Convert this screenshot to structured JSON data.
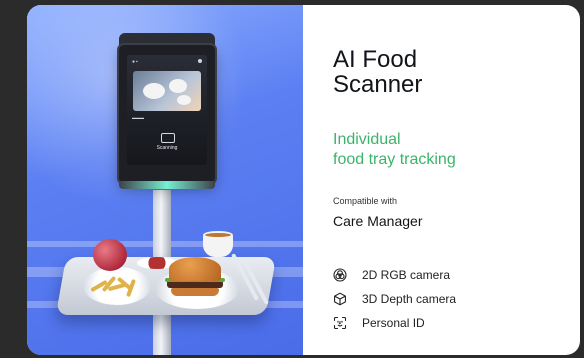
{
  "product": {
    "title_line1": "AI Food",
    "title_line2": "Scanner",
    "subtitle_line1": "Individual",
    "subtitle_line2": "food tray tracking",
    "accent_color": "#3bb46a"
  },
  "compatibility": {
    "label": "Compatible with",
    "value": "Care Manager"
  },
  "features": [
    {
      "icon": "rgb-camera-icon",
      "label": "2D RGB camera"
    },
    {
      "icon": "depth-camera-icon",
      "label": "3D Depth camera"
    },
    {
      "icon": "face-id-icon",
      "label": "Personal ID"
    }
  ],
  "kiosk_screen": {
    "status_text": "Scanning"
  }
}
